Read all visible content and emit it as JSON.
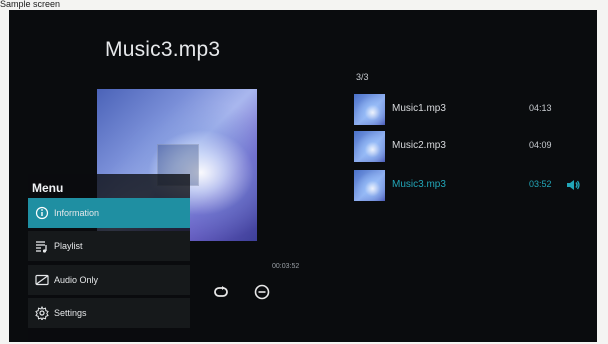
{
  "caption": "Sample screen",
  "player": {
    "title": "Music3.mp3",
    "elapsed": "00:03:52",
    "controls": [
      {
        "name": "repeat-button",
        "icon": "repeat-icon"
      },
      {
        "name": "zoom-out-button",
        "icon": "minus-circle-icon"
      }
    ]
  },
  "playlist": {
    "counter": "3/3",
    "accent_color": "#22a6b8",
    "tracks": [
      {
        "name": "Music1.mp3",
        "duration": "04:13"
      },
      {
        "name": "Music2.mp3",
        "duration": "04:09"
      },
      {
        "name": "Music3.mp3",
        "duration": "03:52",
        "active": true
      }
    ]
  },
  "menu": {
    "title": "Menu",
    "items": [
      {
        "label": "Information",
        "icon": "info-icon",
        "active": true
      },
      {
        "label": "Playlist",
        "icon": "playlist-icon"
      },
      {
        "label": "Audio Only",
        "icon": "audio-only-icon"
      },
      {
        "label": "Settings",
        "icon": "gear-icon"
      }
    ]
  }
}
